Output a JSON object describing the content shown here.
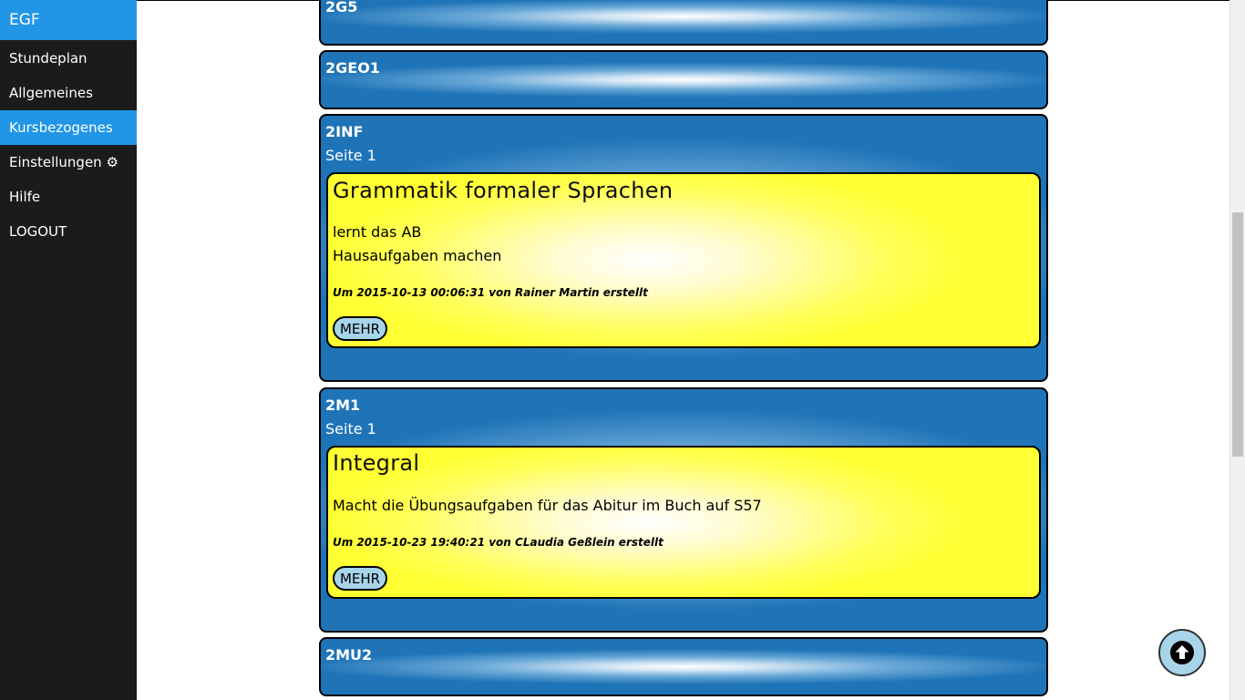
{
  "sidebar": {
    "brand": "EGF",
    "items": [
      {
        "label": "Stundeplan",
        "active": false
      },
      {
        "label": "Allgemeines",
        "active": false
      },
      {
        "label": "Kursbezogenes",
        "active": true
      },
      {
        "label": "Einstellungen ⚙",
        "active": false
      },
      {
        "label": "Hilfe",
        "active": false
      },
      {
        "label": "LOGOUT",
        "active": false
      }
    ]
  },
  "courses": [
    {
      "title": "2G5"
    },
    {
      "title": "2GEO1"
    },
    {
      "title": "2INF",
      "page": "Seite 1",
      "entry": {
        "title": "Grammatik formaler Sprachen",
        "lines": [
          "lernt das AB",
          "Hausaufgaben machen"
        ],
        "meta": "Um 2015-10-13 00:06:31 von Rainer Martin erstellt",
        "button": "MEHR"
      }
    },
    {
      "title": "2M1",
      "page": "Seite 1",
      "entry": {
        "title": "Integral",
        "lines": [
          "Macht die Übungsaufgaben für das Abitur im Buch auf S57"
        ],
        "meta": "Um 2015-10-23 19:40:21 von CLaudia Geßlein erstellt",
        "button": "MEHR"
      }
    },
    {
      "title": "2MU2"
    }
  ],
  "icons": {
    "back_to_top": "arrow-up-circle-icon"
  }
}
